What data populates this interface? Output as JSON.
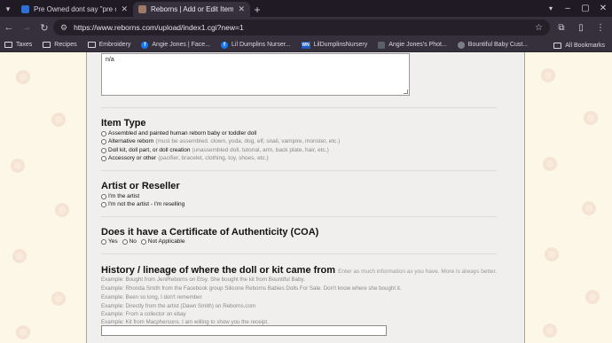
{
  "browser": {
    "tabs": [
      {
        "title": "Pre Owned dont say \"pre owned\"",
        "favicon_color": "#2f6fd0"
      },
      {
        "title": "Reborns | Add or Edit Item",
        "favicon_color": "#9c7b6a"
      }
    ],
    "url": "https://www.reborns.com/upload/index1.cgi?new=1",
    "bookmarks": [
      {
        "label": "Taxes",
        "icon": "folder-icon"
      },
      {
        "label": "Recipes",
        "icon": "folder-icon"
      },
      {
        "label": "Embroidery",
        "icon": "folder-icon"
      },
      {
        "label": "Angie Jones | Face...",
        "icon": "facebook-icon"
      },
      {
        "label": "Lil Dumplins Nurser...",
        "icon": "facebook-icon"
      },
      {
        "label": "LilDumplinsNursery",
        "icon": "wn-icon"
      },
      {
        "label": "Angie Jones's Phot...",
        "icon": "photo-icon"
      },
      {
        "label": "Bountiful Baby Cust...",
        "icon": "globe-icon"
      }
    ],
    "all_bookmarks": "All Bookmarks"
  },
  "form": {
    "textarea_value": "n/a",
    "item_type": {
      "title": "Item Type",
      "options": [
        {
          "label": "Assembled and painted human reborn baby or toddler doll",
          "note": ""
        },
        {
          "label": "Alternative reborn",
          "note": "(must be assembled. clown, yoda, dog, elf, snail, vampire, monster, etc.)"
        },
        {
          "label": "Doll kit, doll part, or doll creation",
          "note": "(unassembled doll, tutorial, arm, back plate, hair, etc.)"
        },
        {
          "label": "Accessory or other",
          "note": "(pacifier, bracelet, clothing, toy, shoes, etc.)"
        }
      ]
    },
    "artist": {
      "title": "Artist or Reseller",
      "options": [
        "I'm the artist",
        "I'm not the artist - I'm reselling"
      ]
    },
    "coa": {
      "title": "Does it have a Certificate of Authenticity (COA)",
      "options": [
        "Yes",
        "No",
        "Not Applicable"
      ]
    },
    "history": {
      "title": "History / lineage of where the doll or kit came from",
      "hint": "Enter as much information as you have. More is always better.",
      "examples": [
        "Example: Bought from JeniReborns on Etsy. She bought the kit from Bountiful Baby.",
        "Example: Rhonda Smith from the Facebook group Silicone Reborns Babies Dolls For Sale. Don't know where she bought it.",
        "Example: Been so long, I don't remember",
        "Example: Directly from the artist (Dawn Smith) on Reborns.com",
        "Example: From a collector on ebay",
        "Example: Kit from Macphersons. I am willing to show you the receipt."
      ],
      "input_value": ""
    }
  }
}
